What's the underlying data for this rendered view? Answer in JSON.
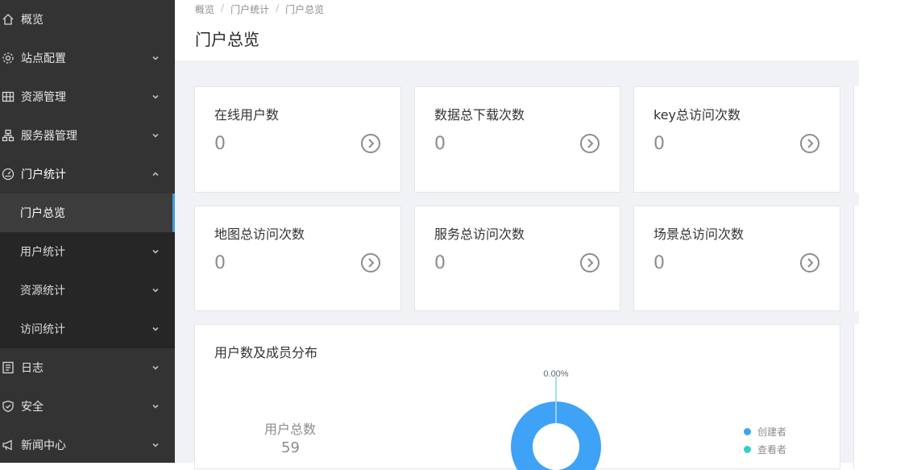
{
  "sidebar": {
    "items": [
      {
        "label": "概览",
        "icon": "home-icon"
      },
      {
        "label": "站点配置",
        "icon": "gear-icon"
      },
      {
        "label": "资源管理",
        "icon": "grid-icon"
      },
      {
        "label": "服务器管理",
        "icon": "server-icon"
      },
      {
        "label": "门户统计",
        "icon": "dashboard-icon"
      },
      {
        "label": "日志",
        "icon": "log-icon"
      },
      {
        "label": "安全",
        "icon": "shield-icon"
      },
      {
        "label": "新闻中心",
        "icon": "megaphone-icon"
      }
    ],
    "sub_items": [
      {
        "label": "门户总览"
      },
      {
        "label": "用户统计"
      },
      {
        "label": "资源统计"
      },
      {
        "label": "访问统计"
      }
    ]
  },
  "breadcrumb": [
    "概览",
    "门户统计",
    "门户总览"
  ],
  "breadcrumb_sep": "/",
  "page_title": "门户总览",
  "stats": [
    {
      "label": "在线用户数",
      "value": "0"
    },
    {
      "label": "数据总下载次数",
      "value": "0"
    },
    {
      "label": "key总访问次数",
      "value": "0"
    },
    {
      "label": "地图总访问次数",
      "value": "0"
    },
    {
      "label": "服务总访问次数",
      "value": "0"
    },
    {
      "label": "场景总访问次数",
      "value": "0"
    }
  ],
  "user_panel": {
    "title": "用户数及成员分布",
    "total_label": "用户总数",
    "total_value": "59",
    "donut_label": "0.00%",
    "legend": [
      {
        "name": "创建者",
        "color": "#3ea2f7"
      },
      {
        "name": "查看者",
        "color": "#36cbcb"
      }
    ]
  },
  "colors": {
    "sidebar_bg": "#333333",
    "accent": "#3f9dd9",
    "donut": "#3ea2f7"
  }
}
